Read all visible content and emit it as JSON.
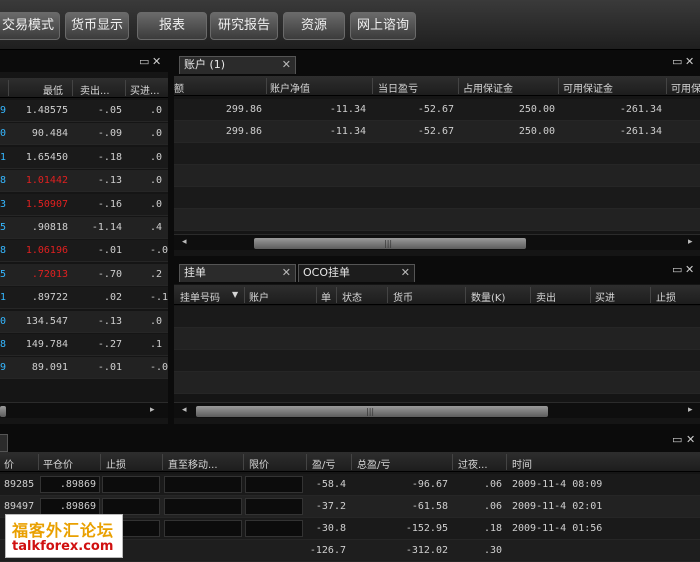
{
  "toolbar": {
    "buttons": [
      "交易模式",
      "货币显示",
      "报表",
      "研究报告",
      "资源",
      "网上谘询"
    ]
  },
  "window_controls": {
    "restore": "▭",
    "close": "✕"
  },
  "rates_panel": {
    "headers": [
      "",
      "最低",
      "卖出...",
      "买进..."
    ],
    "rows": [
      {
        "c0": "9",
        "low": "1.48575",
        "sell": "-.05",
        "buy": ".0",
        "low_color": "normal"
      },
      {
        "c0": "0",
        "low": "90.484",
        "sell": "-.09",
        "buy": ".0",
        "low_color": "normal"
      },
      {
        "c0": "1",
        "low": "1.65450",
        "sell": "-.18",
        "buy": ".0",
        "low_color": "normal"
      },
      {
        "c0": "8",
        "low": "1.01442",
        "sell": "-.13",
        "buy": ".0",
        "low_color": "red"
      },
      {
        "c0": "3",
        "low": "1.50907",
        "sell": "-.16",
        "buy": ".0",
        "low_color": "red"
      },
      {
        "c0": "5",
        "low": ".90818",
        "sell": "-1.14",
        "buy": ".4",
        "low_color": "normal"
      },
      {
        "c0": "8",
        "low": "1.06196",
        "sell": "-.01",
        "buy": "-.0",
        "low_color": "red"
      },
      {
        "c0": "5",
        "low": ".72013",
        "sell": "-.70",
        "buy": ".2",
        "low_color": "red"
      },
      {
        "c0": "1",
        "low": ".89722",
        "sell": ".02",
        "buy": "-.1",
        "low_color": "normal"
      },
      {
        "c0": "0",
        "low": "134.547",
        "sell": "-.13",
        "buy": ".0",
        "low_color": "normal"
      },
      {
        "c0": "8",
        "low": "149.784",
        "sell": "-.27",
        "buy": ".1",
        "low_color": "normal"
      },
      {
        "c0": "9",
        "low": "89.091",
        "sell": "-.01",
        "buy": "-.0",
        "low_color": "normal"
      }
    ]
  },
  "account_panel": {
    "tab": "账户 (1)",
    "headers": [
      "额",
      "账户净值",
      "当日盈亏",
      "占用保证金",
      "可用保证金",
      "可用保"
    ],
    "rows": [
      {
        "a": "299.86",
        "b": "-11.34",
        "c": "-52.67",
        "d": "250.00",
        "e": "-261.34"
      },
      {
        "a": "299.86",
        "b": "-11.34",
        "c": "-52.67",
        "d": "250.00",
        "e": "-261.34"
      }
    ]
  },
  "orders_panel": {
    "tabs": [
      "挂单",
      "OCO挂单"
    ],
    "headers": [
      "挂单号码",
      "账户",
      "单",
      "状态",
      "货币",
      "数量(K)",
      "卖出",
      "买进",
      "止损"
    ]
  },
  "positions_panel": {
    "headers": [
      "价",
      "平仓价",
      "止损",
      "直至移动...",
      "限价",
      "盈/亏",
      "总盈/亏",
      "过夜...",
      "时间"
    ],
    "rows": [
      {
        "price": "89285",
        "close": ".89869",
        "pl": "-58.4",
        "total": "-96.67",
        "overnight": ".06",
        "time": "2009-11-4 08:09"
      },
      {
        "price": "89497",
        "close": ".89869",
        "pl": "-37.2",
        "total": "-61.58",
        "overnight": ".06",
        "time": "2009-11-4 02:01"
      },
      {
        "price": "",
        "close": "",
        "pl": "-30.8",
        "total": "-152.95",
        "overnight": ".18",
        "time": "2009-11-4 01:56"
      }
    ],
    "totals": {
      "pl": "-126.7",
      "total": "-312.02",
      "overnight": ".30"
    }
  },
  "watermark": {
    "line1": "福客外汇论坛",
    "line2": "talkforex.com"
  },
  "colors": {
    "negative_highlight": "#e02020",
    "id_blue": "#35b7ff"
  }
}
